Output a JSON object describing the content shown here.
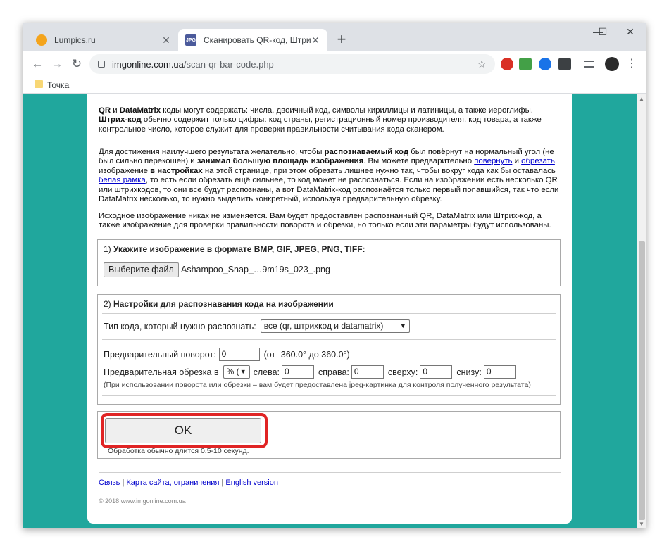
{
  "tabs": [
    {
      "title": "Lumpics.ru",
      "close": "✕"
    },
    {
      "title": "Сканировать QR-код, Штрих-ко",
      "close": "✕",
      "favicon_text": "JPG"
    }
  ],
  "new_tab": "+",
  "window_controls": {
    "minimize": "—",
    "maximize": "☐",
    "close": "✕"
  },
  "nav": {
    "back": "←",
    "forward": "→",
    "reload": "↻"
  },
  "address": {
    "host": "imgonline.com.ua",
    "path": "/scan-qr-bar-code.php",
    "star": "☆"
  },
  "bookmarks": [
    {
      "label": "Точка"
    }
  ],
  "menu_icon": "⋮",
  "content": {
    "p1": {
      "b1": "QR",
      "t1": " и ",
      "b2": "DataMatrix",
      "t2": " коды могут содержать: числа, двоичный код, символы кириллицы и латиницы, а также иероглифы.",
      "b3": "Штрих-код",
      "t3": " обычно содержит только цифры: код страны, регистрационный номер производителя, код товара, а также контрольное число, которое служит для проверки правильности считывания кода сканером."
    },
    "p2": {
      "t1": "Для достижения наилучшего результата желательно, чтобы ",
      "b1": "распознаваемый код",
      "t2": " был повёрнут на нормальный угол (не был сильно перекошен) и ",
      "b2": "занимал большую площадь изображения",
      "t3": ". Вы можете предварительно ",
      "l1": "повернуть",
      "t4": " и ",
      "l2": "обрезать",
      "t5": " изображение ",
      "b3": "в настройках",
      "t6": " на этой странице, при этом обрезать лишнее нужно так, чтобы вокруг кода как бы оставалась ",
      "l3": "белая рамка",
      "t7": ", то есть если обрезать ещё сильнее, то код может не распознаться. Если на изображении есть несколько QR или штрихкодов, то они все будут распознаны, а вот DataMatrix-код распознаётся только первый попавшийся, так что если DataMatrix несколько, то нужно выделить конкретный, используя предварительную обрезку."
    },
    "p3": "Исходное изображение никак не изменяется. Вам будет предоставлен распознанный QR, DataMatrix или Штрих-код, а также изображение для проверки правильности поворота и обрезки, но только если эти параметры будут использованы.",
    "step1": {
      "prefix": "1) ",
      "title": "Укажите изображение в формате BMP, GIF, JPEG, PNG, TIFF:",
      "file_button": "Выберите файл",
      "file_name": "Ashampoo_Snap_…9m19s_023_.png"
    },
    "step2": {
      "prefix": "2) ",
      "title": "Настройки для распознавания кода на изображении",
      "type_label": "Тип кода, который нужно распознать:",
      "type_value": "все (qr, штрихкод и datamatrix)",
      "rotate_label": "Предварительный поворот:",
      "rotate_value": "0",
      "rotate_hint": "(от -360.0° до 360.0°)",
      "crop_label": "Предварительная обрезка в",
      "crop_unit": "% (",
      "left_label": "слева:",
      "left_value": "0",
      "right_label": "справа:",
      "right_value": "0",
      "top_label": "сверху:",
      "top_value": "0",
      "bottom_label": "снизу:",
      "bottom_value": "0",
      "note": "(При использовании поворота или обрезки – вам будет предоставлена jpeg-картинка для контроля полученного результата)"
    },
    "submit": {
      "label": "OK",
      "note": "Обработка обычно длится 0.5-10 секунд."
    },
    "footer": {
      "link1": "Связь",
      "sep1": " | ",
      "link2": "Карта сайта, ограничения",
      "sep2": " | ",
      "link3": "English version",
      "copyright": "© 2018 www.imgonline.com.ua"
    }
  },
  "colors": {
    "page_bg": "#20a79d",
    "highlight": "#e02424",
    "link": "#0000cc"
  }
}
